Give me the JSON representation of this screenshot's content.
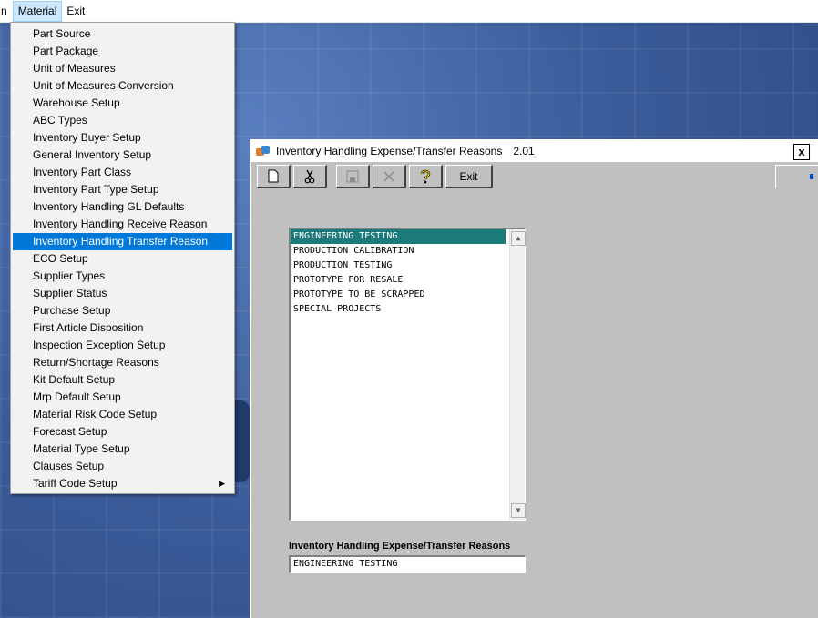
{
  "menubar": {
    "items": [
      {
        "label": "n"
      },
      {
        "label": "Material",
        "active": true
      },
      {
        "label": "Exit"
      }
    ]
  },
  "material_menu": {
    "items": [
      {
        "label": "Part Source"
      },
      {
        "label": "Part Package"
      },
      {
        "label": "Unit of Measures"
      },
      {
        "label": "Unit of Measures Conversion"
      },
      {
        "label": "Warehouse Setup"
      },
      {
        "label": "ABC Types"
      },
      {
        "label": "Inventory Buyer Setup"
      },
      {
        "label": "General Inventory Setup"
      },
      {
        "label": "Inventory Part Class"
      },
      {
        "label": "Inventory Part Type Setup"
      },
      {
        "label": "Inventory Handling GL Defaults"
      },
      {
        "label": "Inventory Handling Receive Reason"
      },
      {
        "label": "Inventory Handling Transfer Reason",
        "highlighted": true
      },
      {
        "label": "ECO Setup"
      },
      {
        "label": "Supplier Types"
      },
      {
        "label": "Supplier Status"
      },
      {
        "label": "Purchase Setup"
      },
      {
        "label": "First Article Disposition"
      },
      {
        "label": "Inspection Exception Setup"
      },
      {
        "label": "Return/Shortage Reasons"
      },
      {
        "label": "Kit Default Setup"
      },
      {
        "label": "Mrp Default Setup"
      },
      {
        "label": "Material Risk Code Setup"
      },
      {
        "label": "Forecast Setup"
      },
      {
        "label": "Material Type Setup"
      },
      {
        "label": "Clauses Setup"
      },
      {
        "label": "Tariff Code Setup",
        "submenu": true
      }
    ]
  },
  "window": {
    "title": "Inventory Handling Expense/Transfer Reasons",
    "version": "2.01",
    "close_glyph": "x",
    "toolbar": {
      "new_icon": "new-document-icon",
      "cut_icon": "scissors-icon",
      "save_icon": "save-icon",
      "delete_icon": "delete-x-icon",
      "help_icon": "question-icon",
      "exit_label": "Exit"
    },
    "reasons": [
      {
        "label": "ENGINEERING TESTING",
        "selected": true
      },
      {
        "label": "PRODUCTION CALIBRATION"
      },
      {
        "label": "PRODUCTION TESTING"
      },
      {
        "label": "PROTOTYPE FOR RESALE"
      },
      {
        "label": "PROTOTYPE TO BE SCRAPPED"
      },
      {
        "label": "SPECIAL PROJECTS"
      }
    ],
    "field_label": "Inventory Handling Expense/Transfer Reasons",
    "field_value": "ENGINEERING TESTING"
  },
  "colors": {
    "menu_highlight": "#0078d7",
    "list_selection": "#1b7a7a",
    "desktop": "#3d5f9e"
  }
}
